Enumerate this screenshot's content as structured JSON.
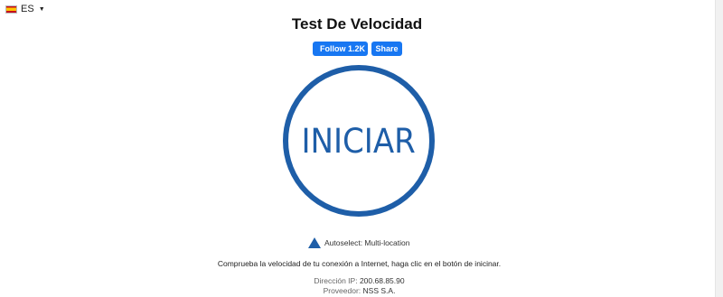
{
  "language": {
    "code": "ES",
    "flag_icon": "spain-flag-icon",
    "caret_icon": "caret-down-icon"
  },
  "title": "Test De Velocidad",
  "social": {
    "follow_label": "Follow 1.2K",
    "share_label": "Share",
    "brand_color": "#1877f2"
  },
  "start_button": {
    "label": "INICIAR",
    "color": "#1e5ea8"
  },
  "server": {
    "icon": "triangle-icon",
    "label": "Autoselect: Multi-location"
  },
  "description": "Comprueba la velocidad de tu conexión a Internet, haga clic en el botón de inicinar.",
  "connection": {
    "ip_label": "Dirección IP:",
    "ip_value": "200.68.85.90",
    "isp_label": "Proveedor:",
    "isp_value": "NSS S.A."
  }
}
